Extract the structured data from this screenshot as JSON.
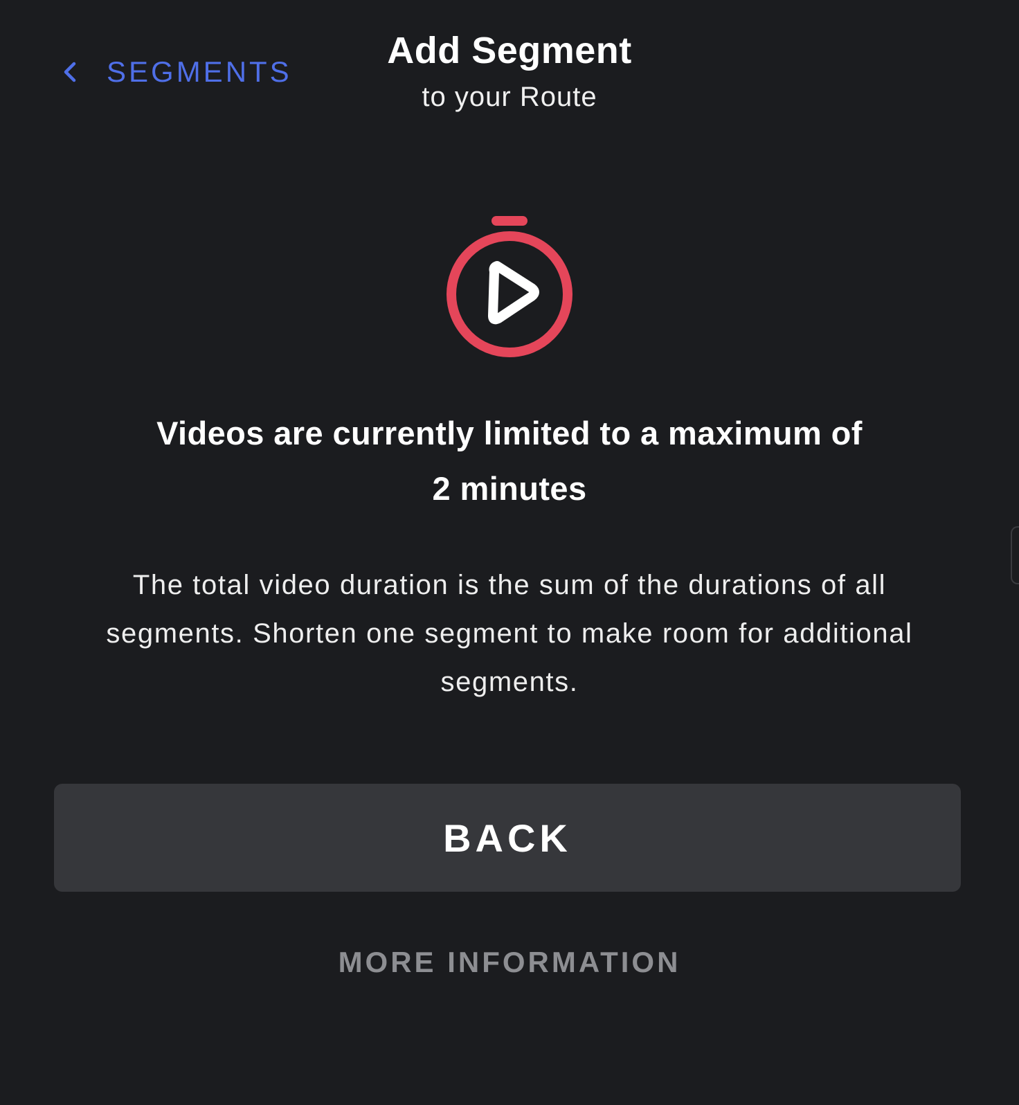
{
  "header": {
    "back_label": "SEGMENTS",
    "back_icon": "chevron-left-icon",
    "title": "Add Segment",
    "subtitle": "to your Route"
  },
  "illustration": {
    "icon": "stopwatch-play-icon",
    "ring_color": "#e5465a",
    "play_color": "#ffffff"
  },
  "message": {
    "headline_line1": "Videos are currently limited to a maximum of",
    "headline_line2": "2 minutes",
    "body": "The total video duration is the sum of the durations of all segments. Shorten one segment to make room for additional segments."
  },
  "actions": {
    "back_button": "BACK",
    "more_info": "MORE INFORMATION"
  },
  "colors": {
    "background": "#1b1c1f",
    "accent": "#4f6fe8",
    "button_bg": "#36373b",
    "muted_text": "#8d8e92"
  }
}
